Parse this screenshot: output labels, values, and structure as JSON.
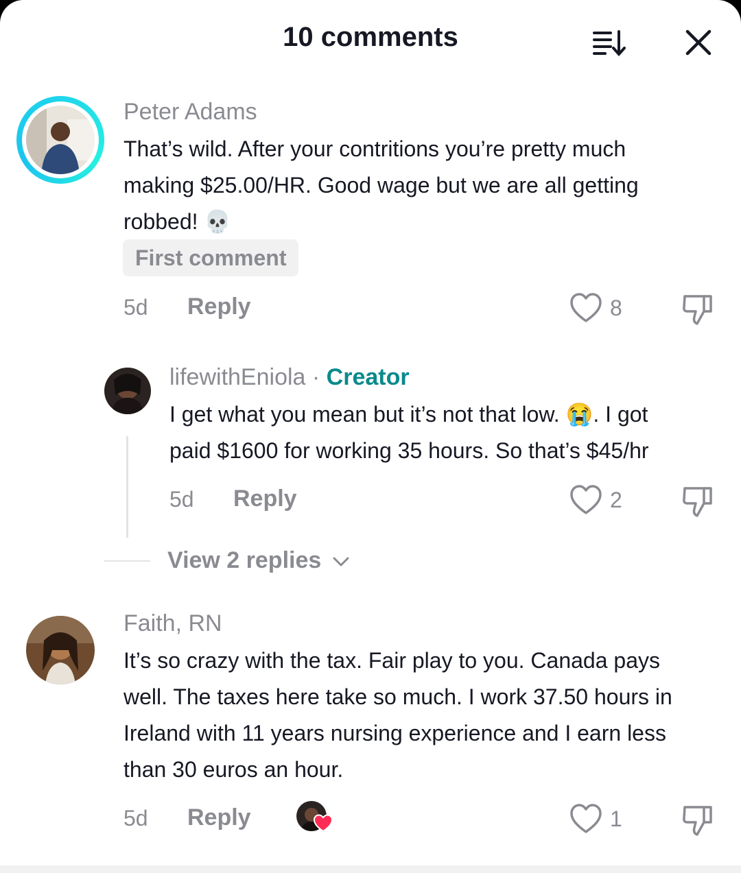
{
  "header": {
    "title": "10 comments"
  },
  "comments": [
    {
      "username": "Peter Adams",
      "text_lines": [
        "That’s wild. After your contritions you’re pretty much",
        "making $25.00/HR. Good wage but we are all getting",
        "robbed! 💀"
      ],
      "badge": "First comment",
      "time": "5d",
      "reply_label": "Reply",
      "likes": "8"
    },
    {
      "username": "lifewithEniola",
      "separator": " · ",
      "creator_label": "Creator",
      "text_lines": [
        "I get what you mean but it’s not that low. 😭. I got",
        "paid $1600 for working 35 hours. So that’s $45/hr"
      ],
      "time": "5d",
      "reply_label": "Reply",
      "likes": "2"
    },
    {
      "username": "Faith, RN",
      "text_lines": [
        "It’s so crazy with the tax. Fair play to you. Canada pays",
        "well. The taxes here take so much. I work 37.50 hours in",
        "Ireland with 11 years nursing experience and I earn less",
        "than 30 euros an hour."
      ],
      "time": "5d",
      "reply_label": "Reply",
      "likes": "1"
    }
  ],
  "view_replies": "View 2 replies",
  "icons": {
    "sort": "sort-icon",
    "close": "close-icon",
    "like": "heart-outline-icon",
    "dislike": "thumbs-down-icon",
    "creator_liked": "heart-badge-icon"
  },
  "colors": {
    "creator": "#0a8a8c",
    "ring": "#20d5ec",
    "muted": "#8a8b91",
    "heart_badge": "#fe2c55"
  }
}
